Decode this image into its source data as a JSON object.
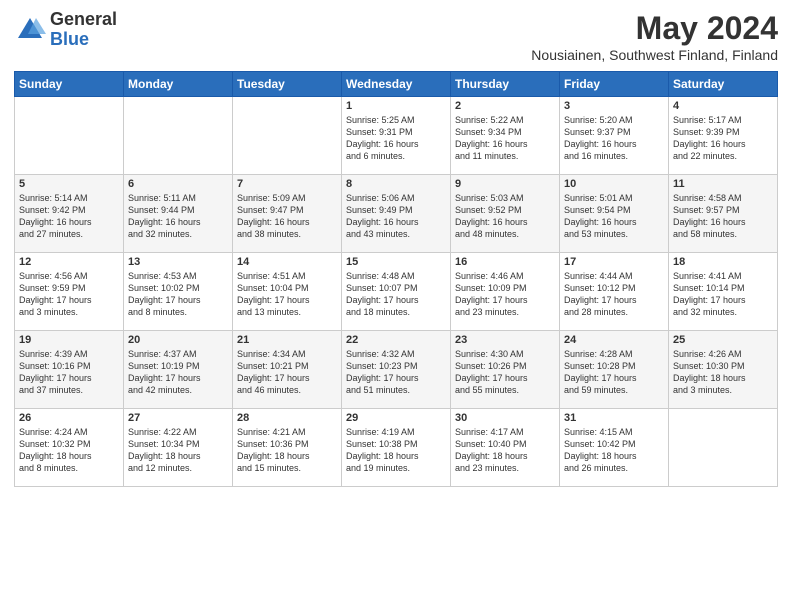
{
  "header": {
    "logo_general": "General",
    "logo_blue": "Blue",
    "month_title": "May 2024",
    "location": "Nousiainen, Southwest Finland, Finland"
  },
  "weekdays": [
    "Sunday",
    "Monday",
    "Tuesday",
    "Wednesday",
    "Thursday",
    "Friday",
    "Saturday"
  ],
  "weeks": [
    [
      {
        "day": "",
        "info": ""
      },
      {
        "day": "",
        "info": ""
      },
      {
        "day": "",
        "info": ""
      },
      {
        "day": "1",
        "info": "Sunrise: 5:25 AM\nSunset: 9:31 PM\nDaylight: 16 hours\nand 6 minutes."
      },
      {
        "day": "2",
        "info": "Sunrise: 5:22 AM\nSunset: 9:34 PM\nDaylight: 16 hours\nand 11 minutes."
      },
      {
        "day": "3",
        "info": "Sunrise: 5:20 AM\nSunset: 9:37 PM\nDaylight: 16 hours\nand 16 minutes."
      },
      {
        "day": "4",
        "info": "Sunrise: 5:17 AM\nSunset: 9:39 PM\nDaylight: 16 hours\nand 22 minutes."
      }
    ],
    [
      {
        "day": "5",
        "info": "Sunrise: 5:14 AM\nSunset: 9:42 PM\nDaylight: 16 hours\nand 27 minutes."
      },
      {
        "day": "6",
        "info": "Sunrise: 5:11 AM\nSunset: 9:44 PM\nDaylight: 16 hours\nand 32 minutes."
      },
      {
        "day": "7",
        "info": "Sunrise: 5:09 AM\nSunset: 9:47 PM\nDaylight: 16 hours\nand 38 minutes."
      },
      {
        "day": "8",
        "info": "Sunrise: 5:06 AM\nSunset: 9:49 PM\nDaylight: 16 hours\nand 43 minutes."
      },
      {
        "day": "9",
        "info": "Sunrise: 5:03 AM\nSunset: 9:52 PM\nDaylight: 16 hours\nand 48 minutes."
      },
      {
        "day": "10",
        "info": "Sunrise: 5:01 AM\nSunset: 9:54 PM\nDaylight: 16 hours\nand 53 minutes."
      },
      {
        "day": "11",
        "info": "Sunrise: 4:58 AM\nSunset: 9:57 PM\nDaylight: 16 hours\nand 58 minutes."
      }
    ],
    [
      {
        "day": "12",
        "info": "Sunrise: 4:56 AM\nSunset: 9:59 PM\nDaylight: 17 hours\nand 3 minutes."
      },
      {
        "day": "13",
        "info": "Sunrise: 4:53 AM\nSunset: 10:02 PM\nDaylight: 17 hours\nand 8 minutes."
      },
      {
        "day": "14",
        "info": "Sunrise: 4:51 AM\nSunset: 10:04 PM\nDaylight: 17 hours\nand 13 minutes."
      },
      {
        "day": "15",
        "info": "Sunrise: 4:48 AM\nSunset: 10:07 PM\nDaylight: 17 hours\nand 18 minutes."
      },
      {
        "day": "16",
        "info": "Sunrise: 4:46 AM\nSunset: 10:09 PM\nDaylight: 17 hours\nand 23 minutes."
      },
      {
        "day": "17",
        "info": "Sunrise: 4:44 AM\nSunset: 10:12 PM\nDaylight: 17 hours\nand 28 minutes."
      },
      {
        "day": "18",
        "info": "Sunrise: 4:41 AM\nSunset: 10:14 PM\nDaylight: 17 hours\nand 32 minutes."
      }
    ],
    [
      {
        "day": "19",
        "info": "Sunrise: 4:39 AM\nSunset: 10:16 PM\nDaylight: 17 hours\nand 37 minutes."
      },
      {
        "day": "20",
        "info": "Sunrise: 4:37 AM\nSunset: 10:19 PM\nDaylight: 17 hours\nand 42 minutes."
      },
      {
        "day": "21",
        "info": "Sunrise: 4:34 AM\nSunset: 10:21 PM\nDaylight: 17 hours\nand 46 minutes."
      },
      {
        "day": "22",
        "info": "Sunrise: 4:32 AM\nSunset: 10:23 PM\nDaylight: 17 hours\nand 51 minutes."
      },
      {
        "day": "23",
        "info": "Sunrise: 4:30 AM\nSunset: 10:26 PM\nDaylight: 17 hours\nand 55 minutes."
      },
      {
        "day": "24",
        "info": "Sunrise: 4:28 AM\nSunset: 10:28 PM\nDaylight: 17 hours\nand 59 minutes."
      },
      {
        "day": "25",
        "info": "Sunrise: 4:26 AM\nSunset: 10:30 PM\nDaylight: 18 hours\nand 3 minutes."
      }
    ],
    [
      {
        "day": "26",
        "info": "Sunrise: 4:24 AM\nSunset: 10:32 PM\nDaylight: 18 hours\nand 8 minutes."
      },
      {
        "day": "27",
        "info": "Sunrise: 4:22 AM\nSunset: 10:34 PM\nDaylight: 18 hours\nand 12 minutes."
      },
      {
        "day": "28",
        "info": "Sunrise: 4:21 AM\nSunset: 10:36 PM\nDaylight: 18 hours\nand 15 minutes."
      },
      {
        "day": "29",
        "info": "Sunrise: 4:19 AM\nSunset: 10:38 PM\nDaylight: 18 hours\nand 19 minutes."
      },
      {
        "day": "30",
        "info": "Sunrise: 4:17 AM\nSunset: 10:40 PM\nDaylight: 18 hours\nand 23 minutes."
      },
      {
        "day": "31",
        "info": "Sunrise: 4:15 AM\nSunset: 10:42 PM\nDaylight: 18 hours\nand 26 minutes."
      },
      {
        "day": "",
        "info": ""
      }
    ]
  ]
}
